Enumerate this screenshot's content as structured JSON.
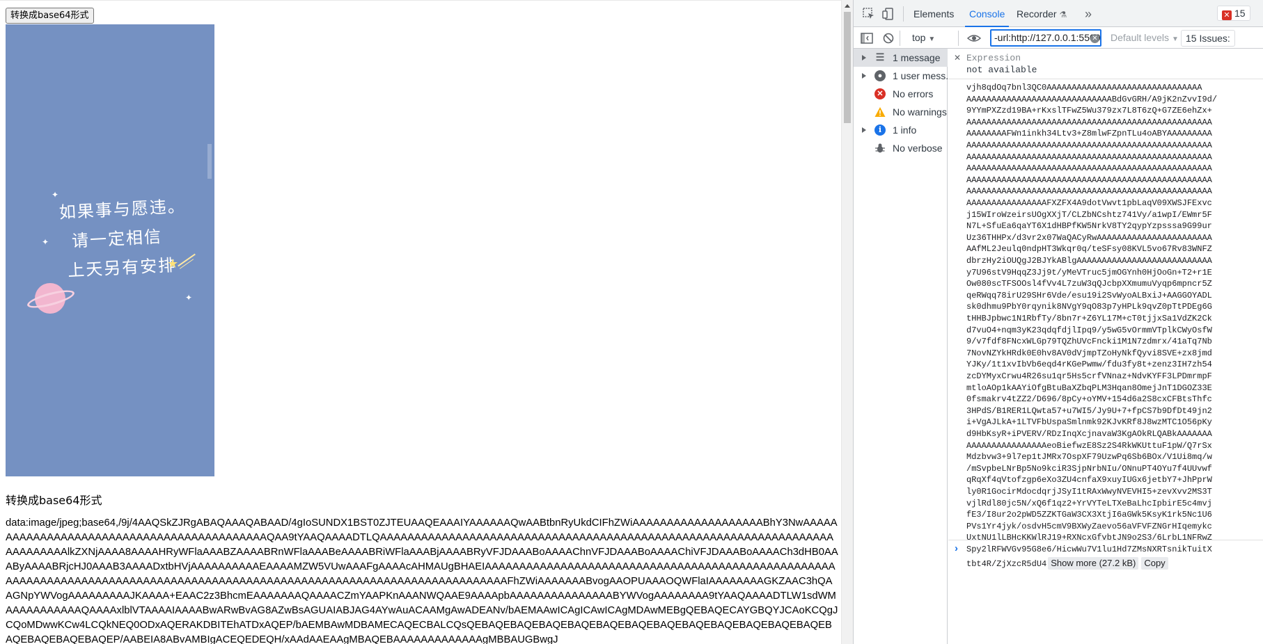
{
  "page": {
    "convert_button": "转换成base64形式",
    "image_quote": [
      "如果事与愿违。",
      "请一定相信",
      "上天另有安排"
    ],
    "section_label": "转换成base64形式",
    "base64_text": "data:image/jpeg;base64,/9j/4AAQSkZJRgABAQAAAQABAAD/4gIoSUNDX1BST0ZJTEUAAQEAAAIYAAAAAAQwAABtbnRyUkdCIFhZWiAAAAAAAAAAAAAAAAAAABhY3NwAAAAAAAAAAAAAAAAAAAAAAAAAAAAAAAAAAAAAAAAAAAQAA9tYAAQAAAADTLQAAAAAAAAAAAAAAAAAAAAAAAAAAAAAAAAAAAAAAAAAAAAAAAAAAAAAAAAAAAAAAAAAAAAAAAAAAAlkZXNjAAAA8AAAAHRyWFlaAAABZAAAABRnWFlaAAABeAAAABRiWFlaAAABjAAAABRyVFJDAAABoAAAAChnVFJDAAABoAAAAChiVFJDAAABoAAAACh3dHB0AAAByAAAABRjcHJ0AAAB3AAAADxtbHVjAAAAAAAAAAEAAAAMZW5VUwAAAFgAAAAcAHMAUgBHAEIAAAAAAAAAAAAAAAAAAAAAAAAAAAAAAAAAAAAAAAAAAAAAAAAAAAAAAAAAAAAAAAAAAAAAAAAAAAAAAAAAAAAAAAAAAAAAAAAAAAAAAAAAAAAAAAAAAAAAAAAAAAAFhZWiAAAAAAABvogAAOPUAAAOQWFlaIAAAAAAAAGKZAAC3hQAAGNpYWVogAAAAAAAAAJKAAAA+EAAC2z3BhcmEAAAAAAAQAAAACZmYAAPKnAAANWQAAE9AAAApbAAAAAAAAAAAAAAABYWVogAAAAAAAA9tYAAQAAAADTLW1sdWMAAAAAAAAAAAQAAAAxlblVTAAAAIAAAABwARwBvAG8AZwBsAGUAIABJAG4AYwAuACAAMgAwADEANv/bAEMAAwICAgICAwICAgMDAwMEBgQEBAQECAYGBQYJCAoKCQgJCQoMDwwKCw4LCQkNEQ0ODxAQERAKDBITEhATDxAQEP/bAEMBAwMDBAMECAQECBALCQsQEBAQEBAQEBAQEBAQEBAQEBAQEBAQEBAQEBAQEBAQEBAQEBAQEBAQEBAQEBAQEBAQEP/AABEIA8ABvAMBIgACEQEDEQH/xAAdAAEAAgMBAQEBAAAAAAAAAAAAAgMBBAUGBwgJ"
  },
  "devtools": {
    "tabs": [
      "Elements",
      "Console",
      "Recorder",
      "»"
    ],
    "active_tab": "Console",
    "error_count": "15",
    "toolbar": {
      "context": "top",
      "filter_value": "-url:http://127.0.0.1:5500",
      "levels": "Default levels",
      "issues": "15 Issues:"
    },
    "sidebar": [
      {
        "label": "1 message",
        "icon": "list-icon",
        "expandable": true
      },
      {
        "label": "1 user mess...",
        "icon": "user-icon",
        "expandable": true
      },
      {
        "label": "No errors",
        "icon": "error-icon",
        "expandable": false
      },
      {
        "label": "No warnings",
        "icon": "warning-icon",
        "expandable": false
      },
      {
        "label": "1 info",
        "icon": "info-icon",
        "expandable": true
      },
      {
        "label": "No verbose",
        "icon": "bug-icon",
        "expandable": false
      }
    ],
    "expression": {
      "label": "Expression",
      "value": "not available"
    },
    "log_lines": [
      "vjh8qdOq7bnl3QC0AAAAAAAAAAAAAAAAAAAAAAAAAAAAAAA",
      "AAAAAAAAAAAAAAAAAAAAAAAAAAAAABdGvGRH/A9jK2nZvvI9d/",
      "9YYmPXZzd19BA+rKxslTFwZ5Wu379zx7L8T6zQ+G7ZE6ehZx+",
      "AAAAAAAAAAAAAAAAAAAAAAAAAAAAAAAAAAAAAAAAAAAAAAAAA",
      "AAAAAAAAFWn1inkh34Ltv3+Z8mlwFZpnTLu4oABYAAAAAAAAA",
      "AAAAAAAAAAAAAAAAAAAAAAAAAAAAAAAAAAAAAAAAAAAAAAAAA",
      "AAAAAAAAAAAAAAAAAAAAAAAAAAAAAAAAAAAAAAAAAAAAAAAAA",
      "AAAAAAAAAAAAAAAAAAAAAAAAAAAAAAAAAAAAAAAAAAAAAAAAA",
      "AAAAAAAAAAAAAAAAAAAAAAAAAAAAAAAAAAAAAAAAAAAAAAAAA",
      "AAAAAAAAAAAAAAAAAAAAAAAAAAAAAAAAAAAAAAAAAAAAAAAAA",
      "AAAAAAAAAAAAAAAAFXZFX4A9dotVwvt1pbLaqV09XWSJFExvc",
      "j15WIroWzeirsUOgXXjT/CLZbNCshtz741Vy/a1wpI/EWmr5F",
      "N7L+SfuEa6qaYT6X1dHBPfKW5NrkV8TY2qypYzpsssa9G99ur",
      "Uz36THHPx/d3vr2x07WaQACyRwAAAAAAAAAAAAAAAAAAAAAAA",
      "AAfML2Jeulq0ndpHT3Wkqr0q/teSFsy08KVL5vo67Rv83WNFZ",
      "dbrzHy2iOUQgJ2BJYkABlgAAAAAAAAAAAAAAAAAAAAAAAAAAA",
      "y7U96stV9HqqZ3Jj9t/yMeVTruc5jmOGYnh0HjOoGn+T2+r1E",
      "Ow080scTFSOOsl4fVv4L7zuW3qQJcbpXXmumuVyqp6mpncr5Z",
      "qeRWqq78irU29SHr6Vde/esu19i2SvWyoALBxiJ+AAGGOYADL",
      "sk0dhmu9PbY0rqynik8NVgY9qO83p7yHPLk9qvZ0pTtPDEg6G",
      "tHHBJpbwc1N1RbfTy/8bn7r+Z6YL17M+cT0tjjxSa1VdZK2Ck",
      "d7vuO4+nqm3yK23qdqfdjlIpq9/y5wG5vOrmmVTplkCWyOsfW",
      "9/v7fdf8FNcxWLGp79TQZhUVcFncki1M1N7zdmrx/41aTq7Nb",
      "7NovNZYkHRdk0E0hv8AV0dVjmpTZoHyNkfQyvi8SVE+zx8jmd",
      "YJKy/1t1xvIbVb6eqd4rKGePwmw/fdu3fy8t+zenz3IH7zh54",
      "zcDYMyxCrwu4R26su1qr5Hs5crfVNnaz+NdvKYFF3LPDmrmpF",
      "mtloAOp1kAAYiOfgBtuBaXZbqPLM3Hqan8OmejJnT1DGOZ33E",
      "0fsmakrv4tZZ2/D696/8pCy+oYMV+154d6a2S8cxCFBtsThfc",
      "3HPdS/B1RER1LQwta57+u7WI5/Jy9U+7+fpCS7b9DfDt49jn2",
      "i+VgAJLkA+1LTVFbUspaSmlnmk92KJvKRf8J8wzMTC1O56pKy",
      "d9HbKsyR+iPVERV/RDzInqXcjnavaW3KgAOkRLQABkAAAAAAA",
      "AAAAAAAAAAAAAAAAeoBiefwzE8Sz2S4RkWKUttuF1pW/Q7rSx",
      "Mdzbvw3+9l7ep1tJMRx7OspXF79UzwPq6Sb6BOx/V1Ui8mq/w",
      "/mSvpbeLNrBp5No9kciR3SjpNrbNIu/ONnuPT4OYu7f4UUvwf",
      "qRqXf4qVtofzgp6eXo3ZU4cnfaX9xuyIUGx6jetbY7+JhPprW",
      "ly0R1GocirMdocdqrjJSyI1tRAxWwyNVEVHI5+zevXvv2MS3T",
      "vjlRdl80jc5N/xQ6f1qz2+YrVYTeLTXeBaLhcIpbirE5c4mvj",
      "fE3/I8ur2o2pWD5ZZKTGaW3CX3XtjI6aGWk5KsyK1rk5Nc1U6",
      "PVs1Yr4jyk/osdvH5cmV9BXWyZaevo56aVFVFZNGrHIqemykc",
      "UxtNU1lLBHcKKWlRJ19+RXNcxGfvbtJN9o2S3/6LrbL1NFRwZ",
      "Spy2lRFWVGv95G8e6/HicwWu7V1lu1Hd7ZMsNXRTsnikTuitX"
    ],
    "last_line": "tbt4R/ZjXzcR5dU4",
    "show_more": "Show more (27.2 kB)",
    "copy": "Copy",
    "prompt": "›"
  },
  "colors": {
    "preview_bg": "#7591c2",
    "accent_blue": "#1a73e8",
    "error_red": "#d93025",
    "warning_yellow": "#f9ab00",
    "info_blue": "#1a73e8"
  }
}
